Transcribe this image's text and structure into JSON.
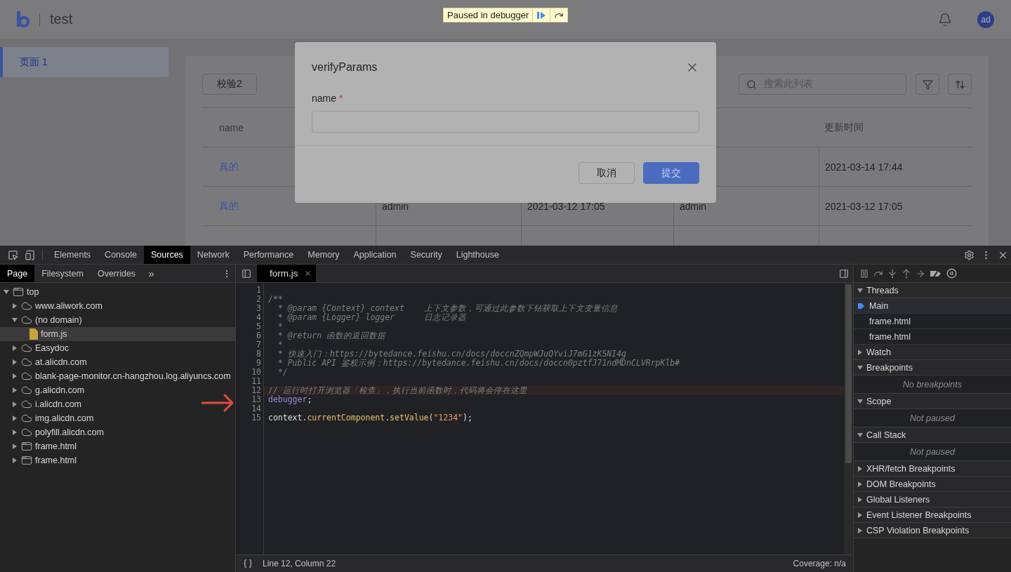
{
  "app": {
    "title": "test",
    "avatar": "ad",
    "banner": {
      "text": "Paused in debugger"
    },
    "sidebar": {
      "items": [
        {
          "label": "页面 1",
          "selected": true
        }
      ]
    },
    "toolbar": {
      "button": "校验2",
      "search_placeholder": "搜索此列表"
    },
    "table": {
      "columns": [
        "name",
        null,
        null,
        null,
        "更新时间"
      ],
      "rows": [
        [
          "真的",
          null,
          null,
          null,
          "2021-03-14 17:44"
        ],
        [
          "真的",
          "admin",
          "2021-03-12 17:05",
          "admin",
          "2021-03-12 17:05"
        ]
      ]
    },
    "modal": {
      "title": "verifyParams",
      "field": {
        "label": "name",
        "required": true
      },
      "buttons": [
        {
          "label": "取消",
          "kind": "default"
        },
        {
          "label": "提交",
          "kind": "primary"
        }
      ]
    }
  },
  "devtools": {
    "tabs": [
      {
        "label": "Elements",
        "selected": false
      },
      {
        "label": "Console",
        "selected": false
      },
      {
        "label": "Sources",
        "selected": true
      },
      {
        "label": "Network",
        "selected": false
      },
      {
        "label": "Performance",
        "selected": false
      },
      {
        "label": "Memory",
        "selected": false
      },
      {
        "label": "Application",
        "selected": false
      },
      {
        "label": "Security",
        "selected": false
      },
      {
        "label": "Lighthouse",
        "selected": false
      }
    ],
    "navigator": {
      "tabs": [
        {
          "label": "Page",
          "selected": true
        },
        {
          "label": "Filesystem",
          "selected": false
        },
        {
          "label": "Overrides",
          "selected": false
        }
      ],
      "more": "»",
      "tree": [
        {
          "label": "top",
          "kind": "frame",
          "expanded": true,
          "selected": false,
          "children": [
            {
              "label": "www.aliwork.com",
              "kind": "domain",
              "expanded": false,
              "selected": false
            },
            {
              "label": "(no domain)",
              "kind": "domain",
              "expanded": true,
              "selected": false,
              "children": [
                {
                  "label": "form.js",
                  "kind": "file",
                  "selected": true
                }
              ]
            },
            {
              "label": "Easydoc",
              "kind": "domain",
              "expanded": false,
              "selected": false
            },
            {
              "label": "at.alicdn.com",
              "kind": "domain",
              "expanded": false,
              "selected": false
            },
            {
              "label": "blank-page-monitor.cn-hangzhou.log.aliyuncs.com",
              "kind": "domain",
              "expanded": false,
              "selected": false
            },
            {
              "label": "g.alicdn.com",
              "kind": "domain",
              "expanded": false,
              "selected": false
            },
            {
              "label": "i.alicdn.com",
              "kind": "domain",
              "expanded": false,
              "selected": false
            },
            {
              "label": "img.alicdn.com",
              "kind": "domain",
              "expanded": false,
              "selected": false
            },
            {
              "label": "polyfill.alicdn.com",
              "kind": "domain",
              "expanded": false,
              "selected": false
            },
            {
              "label": "frame.html",
              "kind": "frame",
              "expanded": false,
              "selected": false
            },
            {
              "label": "frame.html",
              "kind": "frame",
              "expanded": false,
              "selected": false
            }
          ]
        }
      ]
    },
    "editor": {
      "tabs": [
        {
          "label": "form.js",
          "selected": true
        }
      ],
      "lines": [
        {
          "number": "1",
          "current": false
        },
        {
          "number": "2",
          "current": false,
          "tokens": [
            {
              "kind": "comment",
              "text": "/**"
            }
          ]
        },
        {
          "number": "3",
          "current": false,
          "tokens": [
            {
              "kind": "comment",
              "text": "  * @param {Context} context    上下文参数，可通过此参数下钻获取上下文变量信息"
            }
          ]
        },
        {
          "number": "4",
          "current": false,
          "tokens": [
            {
              "kind": "comment",
              "text": "  * @param {Logger} logger      日志记录器"
            }
          ]
        },
        {
          "number": "5",
          "current": false,
          "tokens": [
            {
              "kind": "comment",
              "text": "  *"
            }
          ]
        },
        {
          "number": "6",
          "current": false,
          "tokens": [
            {
              "kind": "comment",
              "text": "  * @return 函数的返回数据"
            }
          ]
        },
        {
          "number": "7",
          "current": false,
          "tokens": [
            {
              "kind": "comment",
              "text": "  *"
            }
          ]
        },
        {
          "number": "8",
          "current": false,
          "tokens": [
            {
              "kind": "comment",
              "text": "  * 快速入门：https://bytedance.feishu.cn/docs/doccnZQmpWJuQYviJ7mG1zKSNI4g"
            }
          ]
        },
        {
          "number": "9",
          "current": false,
          "tokens": [
            {
              "kind": "comment",
              "text": "  * Public API 鉴权示例：https://bytedance.feishu.cn/docs/doccn0pztfJ71ndMDnCLVRrpKlb#"
            }
          ]
        },
        {
          "number": "10",
          "current": false,
          "tokens": [
            {
              "kind": "comment",
              "text": "  */"
            }
          ]
        },
        {
          "number": "11",
          "current": false
        },
        {
          "number": "12",
          "current": true,
          "tokens": [
            {
              "kind": "comment",
              "text": "// 运行时打开浏览器「检查」，执行当前函数时，代码将会停在这里"
            }
          ]
        },
        {
          "number": "13",
          "current": false,
          "tokens": [
            {
              "kind": "keyword",
              "text": "debugger"
            },
            {
              "kind": "plain",
              "text": ";"
            }
          ]
        },
        {
          "number": "14",
          "current": false
        },
        {
          "number": "15",
          "current": false,
          "tokens": [
            {
              "kind": "plain",
              "text": "context."
            },
            {
              "kind": "property",
              "text": "currentComponent"
            },
            {
              "kind": "plain",
              "text": "."
            },
            {
              "kind": "property",
              "text": "setValue"
            },
            {
              "kind": "plain",
              "text": "("
            },
            {
              "kind": "string",
              "text": "\"1234\""
            },
            {
              "kind": "plain",
              "text": ");"
            }
          ]
        }
      ],
      "status": {
        "position": "Line 12, Column 22",
        "coverage": "Coverage: n/a"
      }
    },
    "debugger": {
      "sections": [
        {
          "title": "Threads",
          "expanded": true,
          "items": [
            {
              "label": "Main",
              "selected": true
            },
            {
              "label": "frame.html",
              "selected": false
            },
            {
              "label": "frame.html",
              "selected": false
            }
          ]
        },
        {
          "title": "Watch",
          "expanded": false
        },
        {
          "title": "Breakpoints",
          "expanded": true,
          "message": "No breakpoints"
        },
        {
          "title": "Scope",
          "expanded": true,
          "message": "Not paused"
        },
        {
          "title": "Call Stack",
          "expanded": true,
          "message": "Not paused"
        },
        {
          "title": "XHR/fetch Breakpoints",
          "expanded": false
        },
        {
          "title": "DOM Breakpoints",
          "expanded": false
        },
        {
          "title": "Global Listeners",
          "expanded": false
        },
        {
          "title": "Event Listener Breakpoints",
          "expanded": false
        },
        {
          "title": "CSP Violation Breakpoints",
          "expanded": false
        }
      ]
    }
  }
}
